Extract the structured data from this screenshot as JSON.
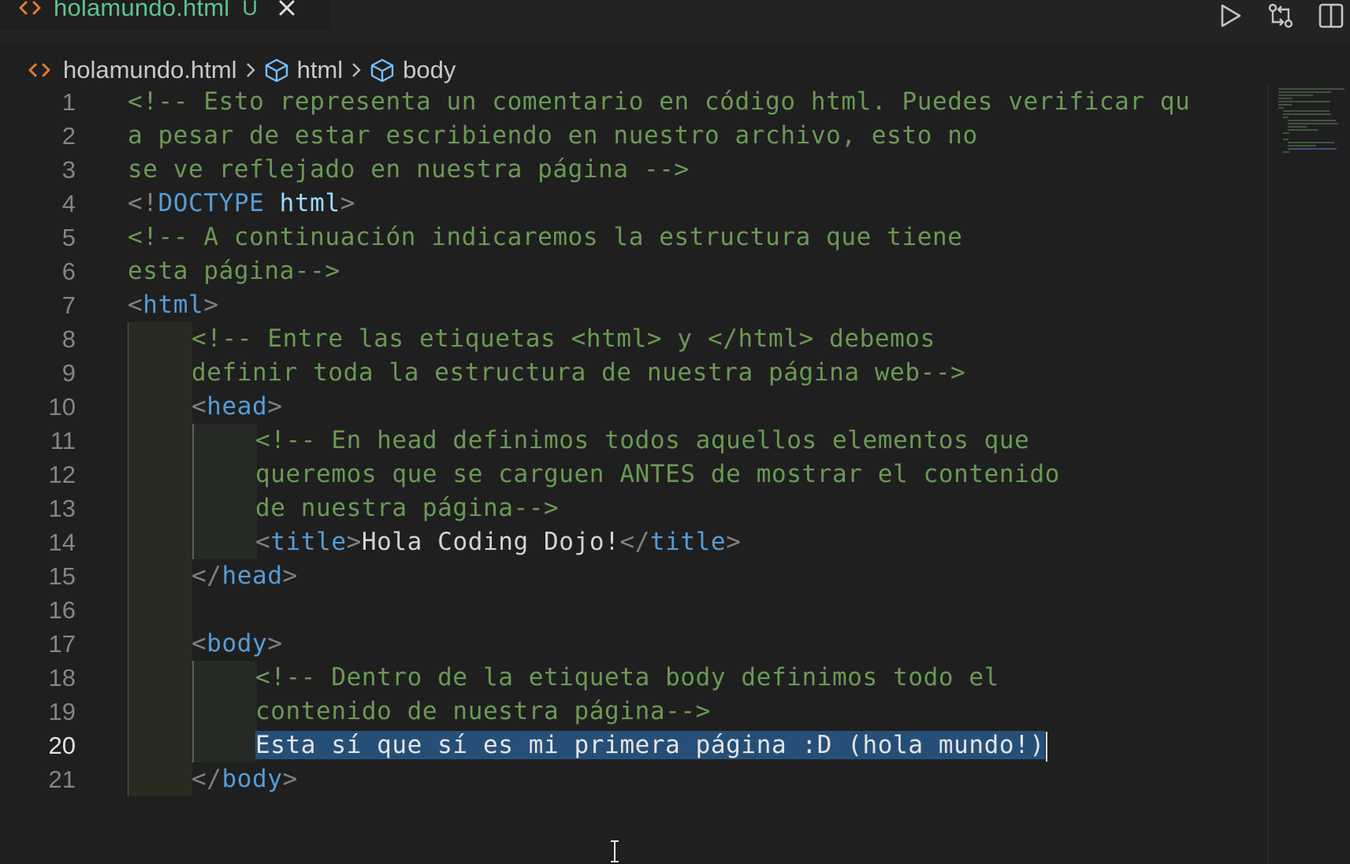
{
  "tab": {
    "label": "holamundo.html",
    "status": "U"
  },
  "icons": {
    "file": "html-file-icon",
    "close": "close-icon",
    "run": "run-icon",
    "compare": "compare-changes-icon",
    "split": "split-editor-icon",
    "element": "symbol-cube-icon"
  },
  "breadcrumb": {
    "file": "holamundo.html",
    "item1": "html",
    "item2": "body"
  },
  "colors": {
    "comment": "#6a9955",
    "tag": "#569cd6",
    "punct": "#808080",
    "text": "#d4d4d4",
    "selection": "#264f78",
    "tab_label": "#5ec48a",
    "file_icon": "#e37933"
  },
  "editor": {
    "active_line": 20,
    "lines": [
      {
        "n": "1",
        "indent": 0,
        "parts": [
          [
            "c-comment",
            "<!-- Esto representa un comentario en código html. Puedes verificar qu"
          ]
        ]
      },
      {
        "n": "2",
        "indent": 0,
        "parts": [
          [
            "c-comment",
            "a pesar de estar escribiendo en nuestro archivo, esto no"
          ]
        ]
      },
      {
        "n": "3",
        "indent": 0,
        "parts": [
          [
            "c-comment",
            "se ve reflejado en nuestra página -->"
          ]
        ]
      },
      {
        "n": "4",
        "indent": 0,
        "parts": [
          [
            "c-punct",
            "<!"
          ],
          [
            "c-tag",
            "DOCTYPE"
          ],
          [
            "c-text",
            " "
          ],
          [
            "c-attr",
            "html"
          ],
          [
            "c-punct",
            ">"
          ]
        ]
      },
      {
        "n": "5",
        "indent": 0,
        "parts": [
          [
            "c-comment",
            "<!-- A continuación indicaremos la estructura que tiene"
          ]
        ]
      },
      {
        "n": "6",
        "indent": 0,
        "parts": [
          [
            "c-comment",
            "esta página-->"
          ]
        ]
      },
      {
        "n": "7",
        "indent": 0,
        "parts": [
          [
            "c-punct",
            "<"
          ],
          [
            "c-tag",
            "html"
          ],
          [
            "c-punct",
            ">"
          ]
        ]
      },
      {
        "n": "8",
        "indent": 1,
        "parts": [
          [
            "c-comment",
            "<!-- Entre las etiquetas <html> y </html> debemos"
          ]
        ]
      },
      {
        "n": "9",
        "indent": 1,
        "parts": [
          [
            "c-comment",
            "definir toda la estructura de nuestra página web-->"
          ]
        ]
      },
      {
        "n": "10",
        "indent": 1,
        "parts": [
          [
            "c-punct",
            "<"
          ],
          [
            "c-tag",
            "head"
          ],
          [
            "c-punct",
            ">"
          ]
        ]
      },
      {
        "n": "11",
        "indent": 2,
        "parts": [
          [
            "c-comment",
            "<!-- En head definimos todos aquellos elementos que"
          ]
        ]
      },
      {
        "n": "12",
        "indent": 2,
        "parts": [
          [
            "c-comment",
            "queremos que se carguen ANTES de mostrar el contenido"
          ]
        ]
      },
      {
        "n": "13",
        "indent": 2,
        "parts": [
          [
            "c-comment",
            "de nuestra página-->"
          ]
        ]
      },
      {
        "n": "14",
        "indent": 2,
        "parts": [
          [
            "c-punct",
            "<"
          ],
          [
            "c-tag",
            "title"
          ],
          [
            "c-punct",
            ">"
          ],
          [
            "c-text",
            "Hola Coding Dojo!"
          ],
          [
            "c-punct",
            "</"
          ],
          [
            "c-tag",
            "title"
          ],
          [
            "c-punct",
            ">"
          ]
        ]
      },
      {
        "n": "15",
        "indent": 1,
        "parts": [
          [
            "c-punct",
            "</"
          ],
          [
            "c-tag",
            "head"
          ],
          [
            "c-punct",
            ">"
          ]
        ]
      },
      {
        "n": "16",
        "indent": 0,
        "parts": []
      },
      {
        "n": "17",
        "indent": 1,
        "parts": [
          [
            "c-punct",
            "<"
          ],
          [
            "c-tag",
            "body"
          ],
          [
            "c-punct",
            ">"
          ]
        ]
      },
      {
        "n": "18",
        "indent": 2,
        "parts": [
          [
            "c-comment",
            "<!-- Dentro de la etiqueta body definimos todo el"
          ]
        ]
      },
      {
        "n": "19",
        "indent": 2,
        "parts": [
          [
            "c-comment",
            "contenido de nuestra página-->"
          ]
        ]
      },
      {
        "n": "20",
        "indent": 2,
        "parts": [
          [
            "sel",
            "Esta sí que sí es mi primera página :D (hola mundo!)"
          ]
        ]
      },
      {
        "n": "21",
        "indent": 1,
        "parts": [
          [
            "c-punct",
            "</"
          ],
          [
            "c-tag",
            "body"
          ],
          [
            "c-punct",
            ">"
          ]
        ]
      }
    ]
  }
}
